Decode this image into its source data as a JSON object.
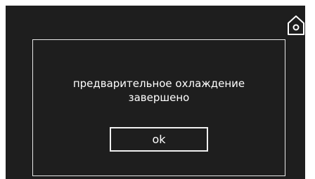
{
  "screen": {
    "background": "#1e1e1e"
  },
  "home_button": {
    "icon": "home-icon"
  },
  "dialog": {
    "message_line1": "предварительное охлаждение",
    "message_line2": "завершено",
    "ok_label": "ok"
  }
}
